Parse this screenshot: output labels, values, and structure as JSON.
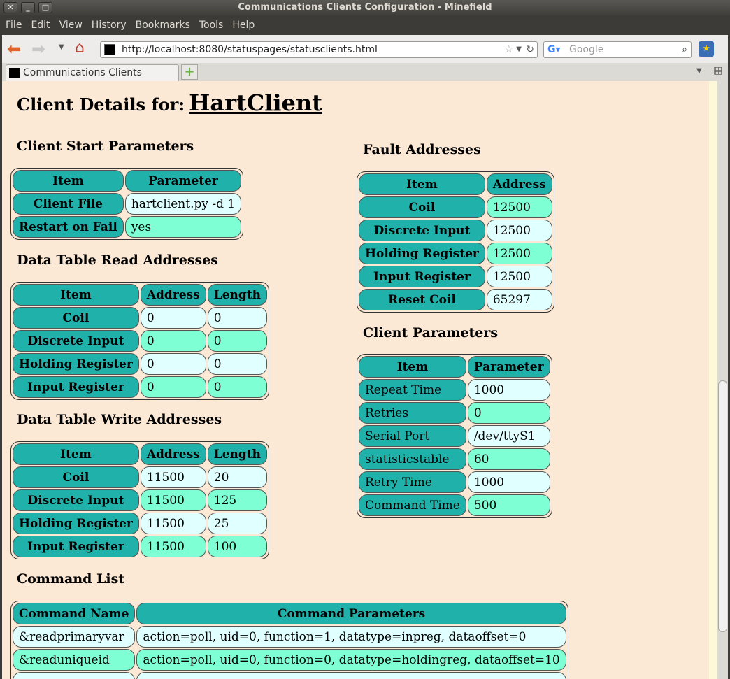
{
  "window": {
    "title": "Communications Clients Configuration - Minefield"
  },
  "menu": [
    "File",
    "Edit",
    "View",
    "History",
    "Bookmarks",
    "Tools",
    "Help"
  ],
  "url": "http://localhost:8080/statuspages/statusclients.html",
  "search_placeholder": "Google",
  "tab_title": "Communications Clients Config...",
  "page": {
    "title_prefix": "Client Details for:",
    "client_name": "HartClient",
    "start": {
      "heading": "Client Start Parameters",
      "headers": [
        "Item",
        "Parameter"
      ],
      "rows": [
        [
          "Client File",
          "hartclient.py -d 1"
        ],
        [
          "Restart on Fail",
          "yes"
        ]
      ]
    },
    "read": {
      "heading": "Data Table Read Addresses",
      "headers": [
        "Item",
        "Address",
        "Length"
      ],
      "rows": [
        [
          "Coil",
          "0",
          "0"
        ],
        [
          "Discrete Input",
          "0",
          "0"
        ],
        [
          "Holding Register",
          "0",
          "0"
        ],
        [
          "Input Register",
          "0",
          "0"
        ]
      ]
    },
    "write": {
      "heading": "Data Table Write Addresses",
      "headers": [
        "Item",
        "Address",
        "Length"
      ],
      "rows": [
        [
          "Coil",
          "11500",
          "20"
        ],
        [
          "Discrete Input",
          "11500",
          "125"
        ],
        [
          "Holding Register",
          "11500",
          "25"
        ],
        [
          "Input Register",
          "11500",
          "100"
        ]
      ]
    },
    "fault": {
      "heading": "Fault Addresses",
      "headers": [
        "Item",
        "Address"
      ],
      "rows": [
        [
          "Coil",
          "12500"
        ],
        [
          "Discrete Input",
          "12500"
        ],
        [
          "Holding Register",
          "12500"
        ],
        [
          "Input Register",
          "12500"
        ],
        [
          "Reset Coil",
          "65297"
        ]
      ]
    },
    "params": {
      "heading": "Client Parameters",
      "headers": [
        "Item",
        "Parameter"
      ],
      "rows": [
        [
          "Repeat Time",
          "1000"
        ],
        [
          "Retries",
          "0"
        ],
        [
          "Serial Port",
          "/dev/ttyS1"
        ],
        [
          "statisticstable",
          "60"
        ],
        [
          "Retry Time",
          "1000"
        ],
        [
          "Command Time",
          "500"
        ]
      ]
    },
    "commands": {
      "heading": "Command List",
      "headers": [
        "Command Name",
        "Command Parameters"
      ],
      "rows": [
        [
          "&readprimaryvar",
          "action=poll, uid=0, function=1, datatype=inpreg, dataoffset=0"
        ],
        [
          "&readuniqueid",
          "action=poll, uid=0, function=0, datatype=holdingreg, dataoffset=10"
        ]
      ]
    }
  }
}
